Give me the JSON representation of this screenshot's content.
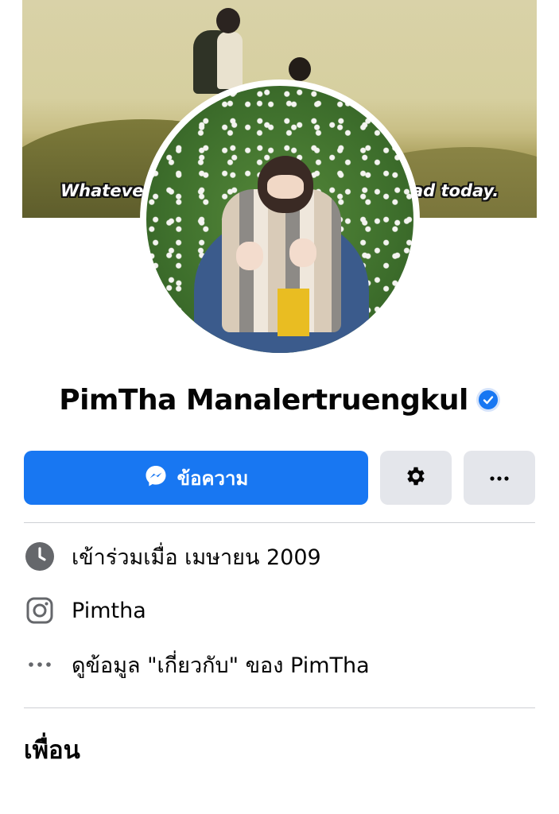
{
  "cover": {
    "subtitle_left": "Whateve",
    "subtitle_right": "ad today."
  },
  "profile": {
    "name": "PimTha Manalertruengkul",
    "verified": true
  },
  "actions": {
    "message_label": "ข้อความ",
    "settings_icon": "gear-icon",
    "more_icon": "more-horizontal-icon"
  },
  "intro": {
    "items": [
      {
        "icon": "clock-icon",
        "text": "เข้าร่วมเมื่อ เมษายน  2009"
      },
      {
        "icon": "instagram-icon",
        "text": "Pimtha"
      },
      {
        "icon": "more-horizontal-icon",
        "text": "ดูข้อมูล \"เกี่ยวกับ\" ของ PimTha"
      }
    ]
  },
  "friends": {
    "title": "เพื่อน"
  },
  "colors": {
    "accent": "#1877f2",
    "secondary_button": "#e4e6eb",
    "icon_gray": "#65676b",
    "divider": "#ced0d4"
  }
}
